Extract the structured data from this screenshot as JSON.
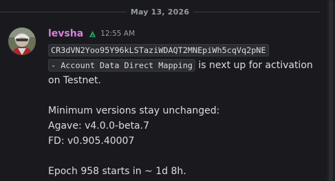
{
  "date_divider": "May 13, 2026",
  "message": {
    "username": "levsha",
    "role_icon": "sprout-icon",
    "timestamp": "12:55 AM",
    "code_line_1": "CR3dVN2Yoo95Y96kLSTaziWDAQT2MNEpiWh5cqVq2pNE",
    "code_line_2": "- Account Data Direct Mapping",
    "intro_text": " is next up for activation on Testnet.",
    "versions_heading": "Minimum versions stay unchanged:",
    "agave_line": "Agave: v4.0.0-beta.7",
    "fd_line": "FD: v0.905.40007",
    "epoch_line": "Epoch 958 starts in ~ 1d 8h."
  },
  "colors": {
    "background": "#1a1a1e",
    "username": "#d780de",
    "role_icon": "#23a55a",
    "text": "#dbdee1",
    "muted": "#949ba4"
  }
}
